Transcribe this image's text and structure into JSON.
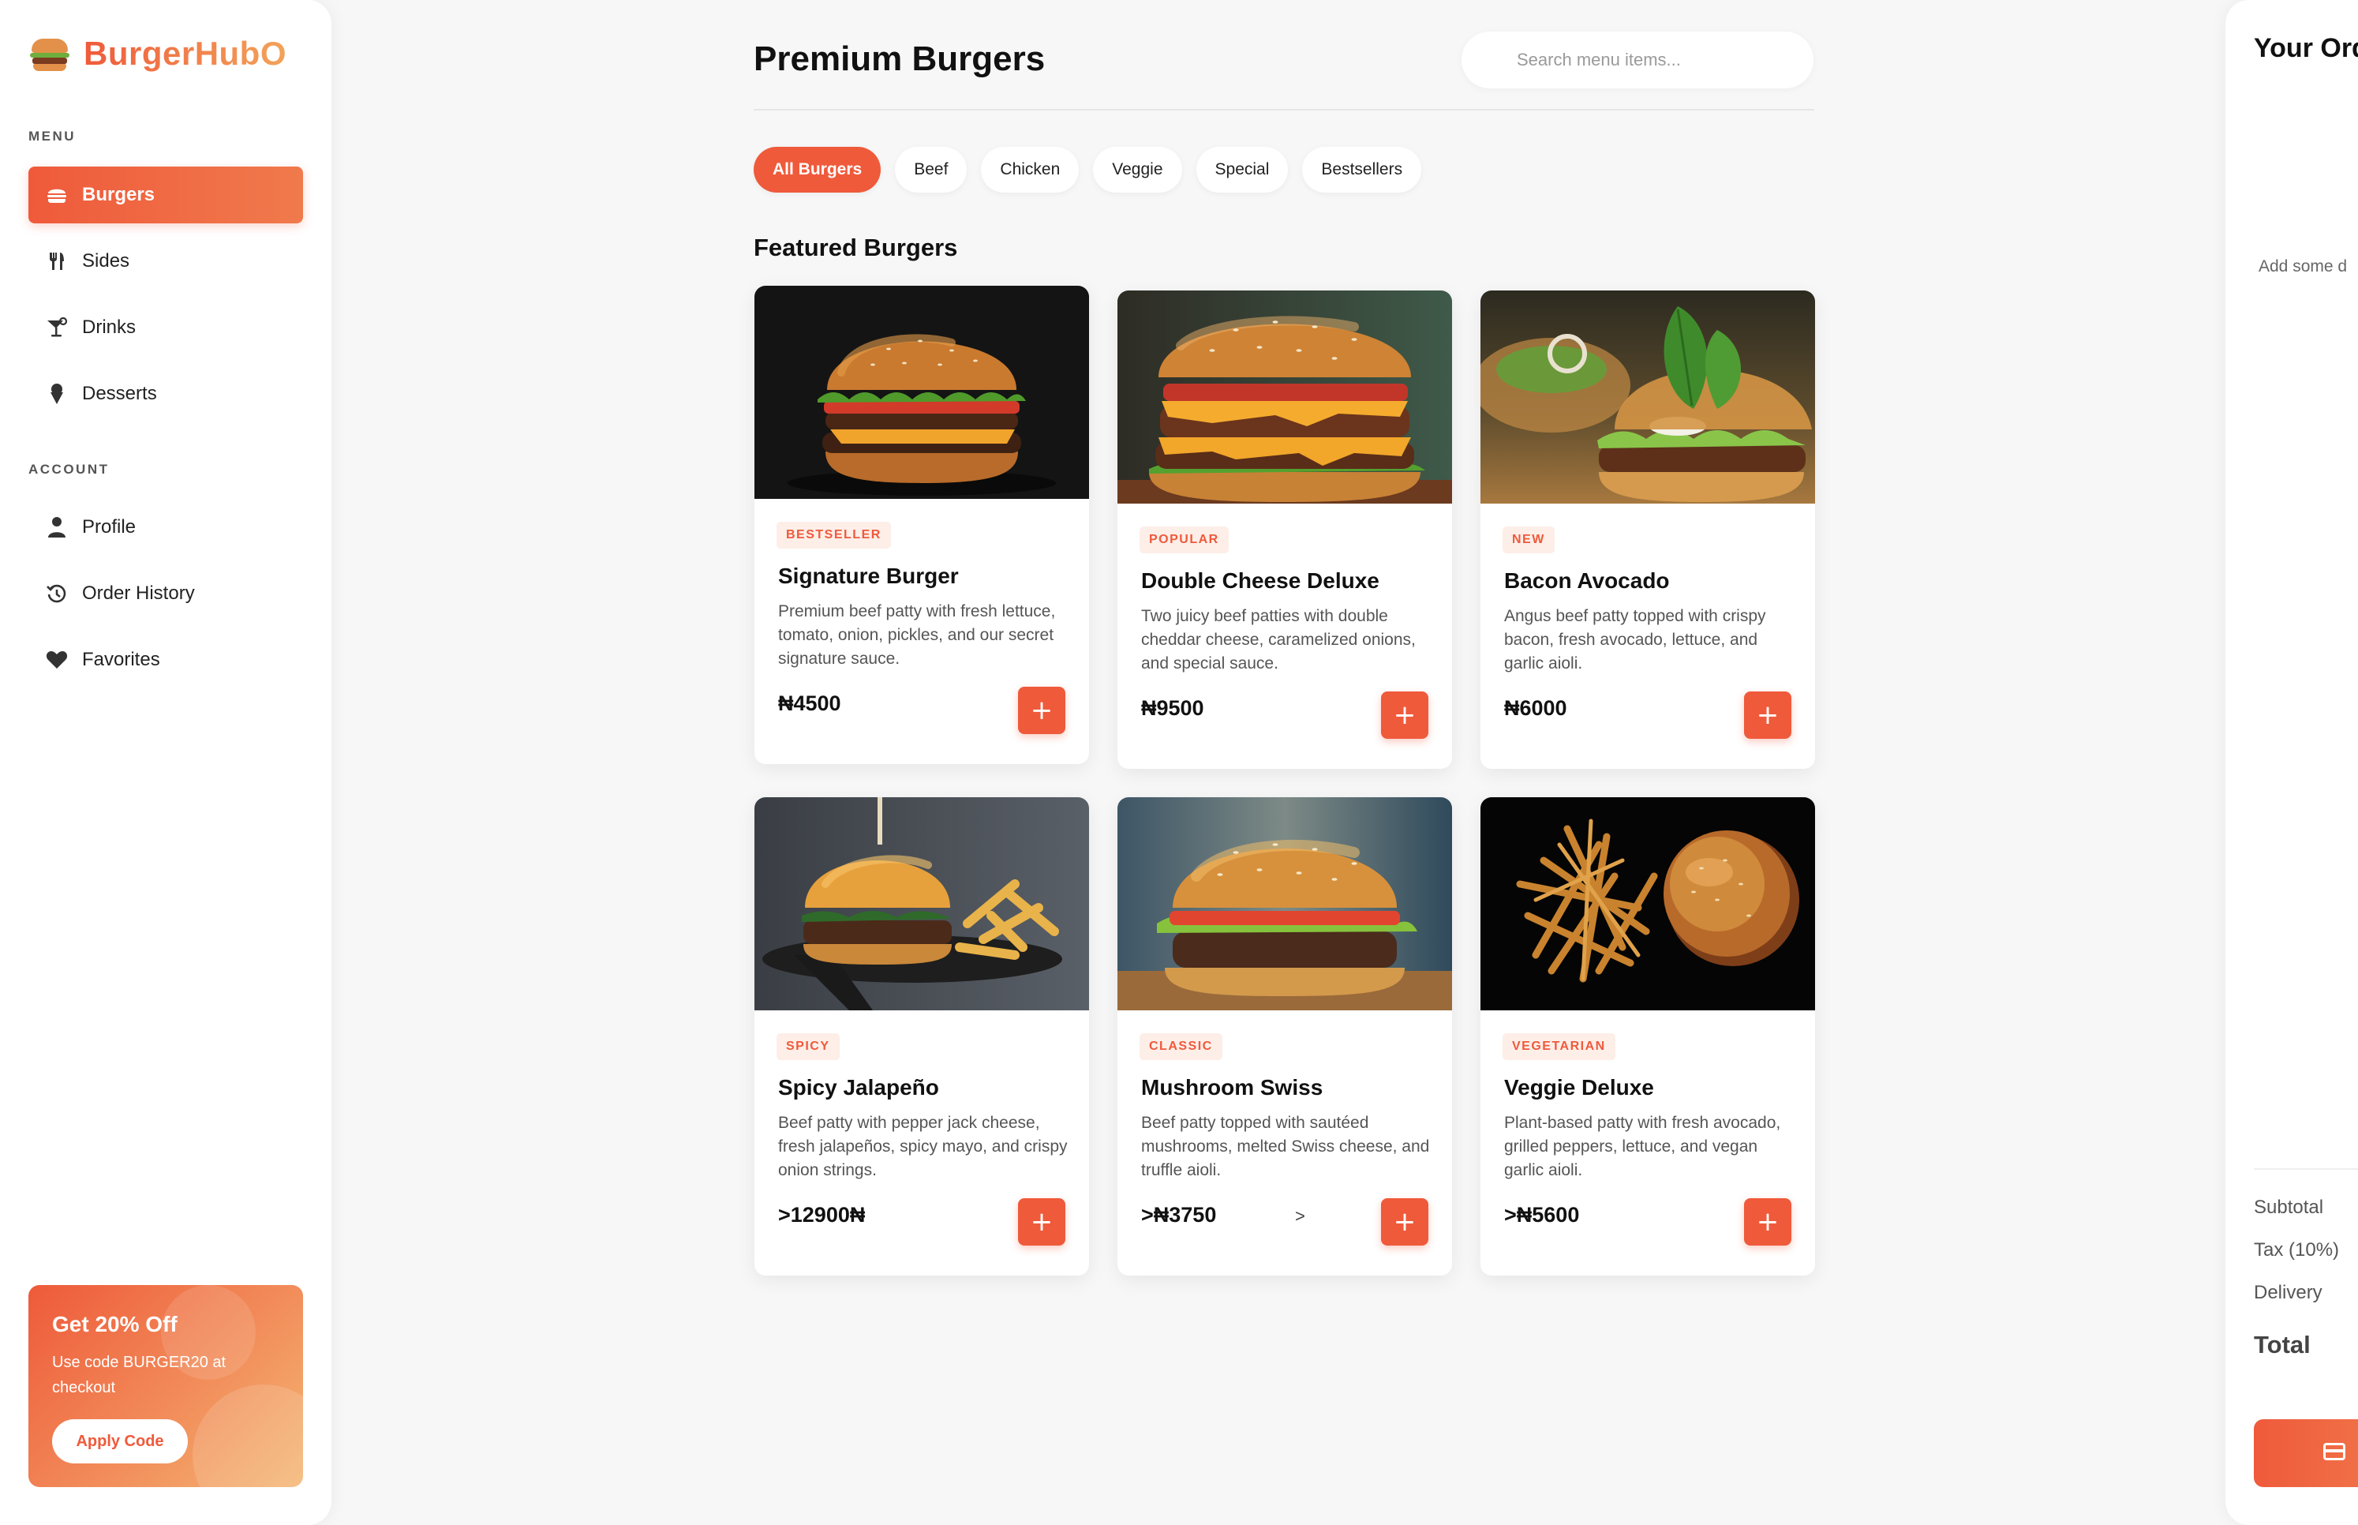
{
  "brand": {
    "name": "BurgerHubO"
  },
  "sidebar": {
    "menu_label": "MENU",
    "menu_items": [
      {
        "label": "Burgers",
        "icon": "burger-icon"
      },
      {
        "label": "Sides",
        "icon": "utensils-icon"
      },
      {
        "label": "Drinks",
        "icon": "cocktail-icon"
      },
      {
        "label": "Desserts",
        "icon": "ice-cream-icon"
      }
    ],
    "account_label": "ACCOUNT",
    "account_items": [
      {
        "label": "Profile",
        "icon": "user-icon"
      },
      {
        "label": "Order History",
        "icon": "history-icon"
      },
      {
        "label": "Favorites",
        "icon": "heart-icon"
      }
    ],
    "promo": {
      "title": "Get 20% Off",
      "text": "Use code BURGER20 at checkout",
      "button": "Apply Code"
    }
  },
  "main": {
    "title": "Premium Burgers",
    "search_placeholder": "Search menu items...",
    "filters": [
      "All Burgers",
      "Beef",
      "Chicken",
      "Veggie",
      "Special",
      "Bestsellers"
    ],
    "active_filter": "All Burgers",
    "section_title": "Featured Burgers",
    "products": [
      {
        "badge": "BESTSELLER",
        "name": "Signature Burger",
        "description": "Premium beef patty with fresh lettuce, tomato, onion, pickles, and our secret signature sauce.",
        "price": "₦4500"
      },
      {
        "badge": "POPULAR",
        "name": "Double Cheese Deluxe",
        "description": "Two juicy beef patties with double cheddar cheese, caramelized onions, and special sauce.",
        "price": "₦9500"
      },
      {
        "badge": "NEW",
        "name": "Bacon Avocado",
        "description": "Angus beef patty topped with crispy bacon, fresh avocado, lettuce, and garlic aioli.",
        "price": "₦6000"
      },
      {
        "badge": "SPICY",
        "name": "Spicy Jalapeño",
        "description": "Beef patty with pepper jack cheese, fresh jalapeños, spicy mayo, and crispy onion strings.",
        "price": ">12900₦"
      },
      {
        "badge": "CLASSIC",
        "name": "Mushroom Swiss",
        "description": "Beef patty topped with sautéed mushrooms, melted Swiss cheese, and truffle aioli.",
        "price": ">₦3750",
        "extra": ">"
      },
      {
        "badge": "VEGETARIAN",
        "name": "Veggie Deluxe",
        "description": "Plant-based patty with fresh avocado, grilled peppers, lettuce, and vegan garlic aioli.",
        "price": ">₦5600"
      }
    ],
    "add_label": "+"
  },
  "order": {
    "title": "Your Ord",
    "empty_text": "Add some d",
    "subtotal_label": "Subtotal",
    "tax_label": "Tax (10%)",
    "delivery_label": "Delivery",
    "total_label": "Total"
  },
  "colors": {
    "accent": "#ef5a3b",
    "accent_light": "#f2a35a",
    "background": "#f7f7f7"
  }
}
